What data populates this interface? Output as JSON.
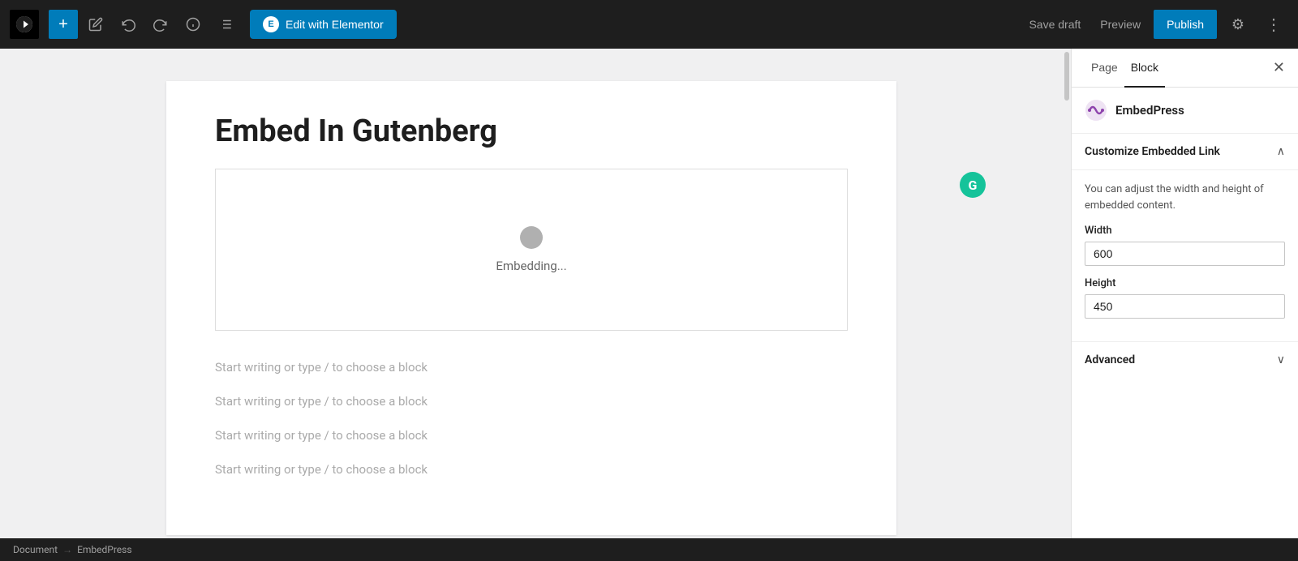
{
  "toolbar": {
    "plus_label": "+",
    "undo_label": "↩",
    "redo_label": "↪",
    "info_label": "ℹ",
    "list_label": "≡",
    "elementor_btn_label": "Edit with Elementor",
    "elementor_icon": "E",
    "save_draft_label": "Save draft",
    "preview_label": "Preview",
    "publish_label": "Publish",
    "settings_icon": "⚙",
    "more_icon": "⋮"
  },
  "page": {
    "title": "Embed In Gutenberg",
    "grammarly_icon": "G",
    "embed_block": {
      "loading_text": "Embedding..."
    },
    "placeholders": [
      "Start writing or type / to choose a block",
      "Start writing or type / to choose a block",
      "Start writing or type / to choose a block",
      "Start writing or type / to choose a block"
    ]
  },
  "sidebar": {
    "tab_page": "Page",
    "tab_block": "Block",
    "close_icon": "✕",
    "embedpress_label": "EmbedPress",
    "customize_section": {
      "title": "Customize Embedded Link",
      "chevron": "∧",
      "description": "You can adjust the width and height of embedded content.",
      "width_label": "Width",
      "width_value": "600",
      "height_label": "Height",
      "height_value": "450"
    },
    "advanced_section": {
      "title": "Advanced",
      "chevron": "∨"
    }
  },
  "statusbar": {
    "document_label": "Document",
    "separator": "→",
    "context_label": "EmbedPress"
  }
}
